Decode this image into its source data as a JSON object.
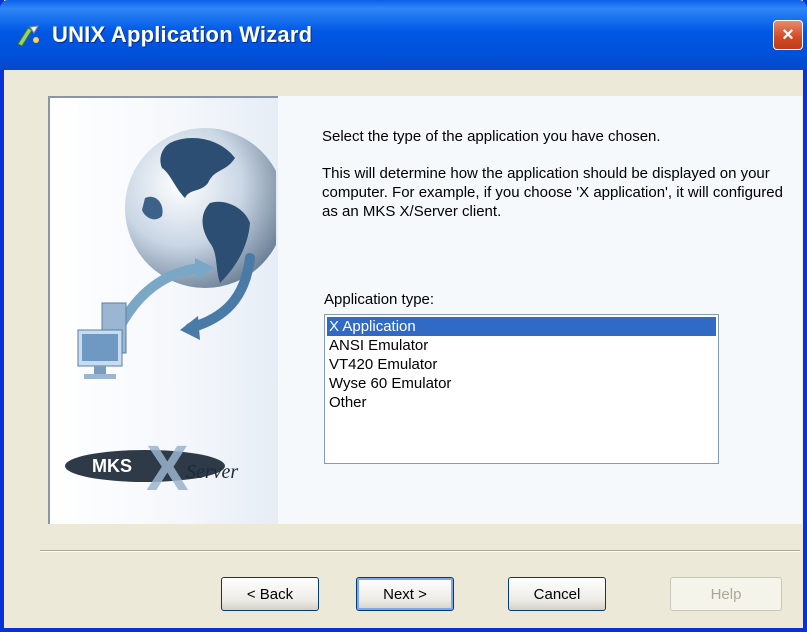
{
  "window": {
    "title": "UNIX Application Wizard",
    "close_label": "×"
  },
  "content": {
    "intro": "Select the type of the application you have chosen.",
    "description": "This will determine how the application should be displayed on your computer. For example, if you choose 'X application', it will configured as an MKS X/Server client.",
    "list_label": "Application type:",
    "list_items": [
      "X Application",
      "ANSI Emulator",
      "VT420 Emulator",
      "Wyse 60 Emulator",
      "Other"
    ],
    "selected_index": 0
  },
  "logo": {
    "text_mks": "MKS",
    "text_x": "X",
    "text_server": "Server"
  },
  "buttons": {
    "back": "< Back",
    "next": "Next >",
    "cancel": "Cancel",
    "help": "Help"
  },
  "colors": {
    "titlebar": "#0058e6",
    "selection": "#316ac5",
    "dialog_bg": "#ece9d8"
  }
}
